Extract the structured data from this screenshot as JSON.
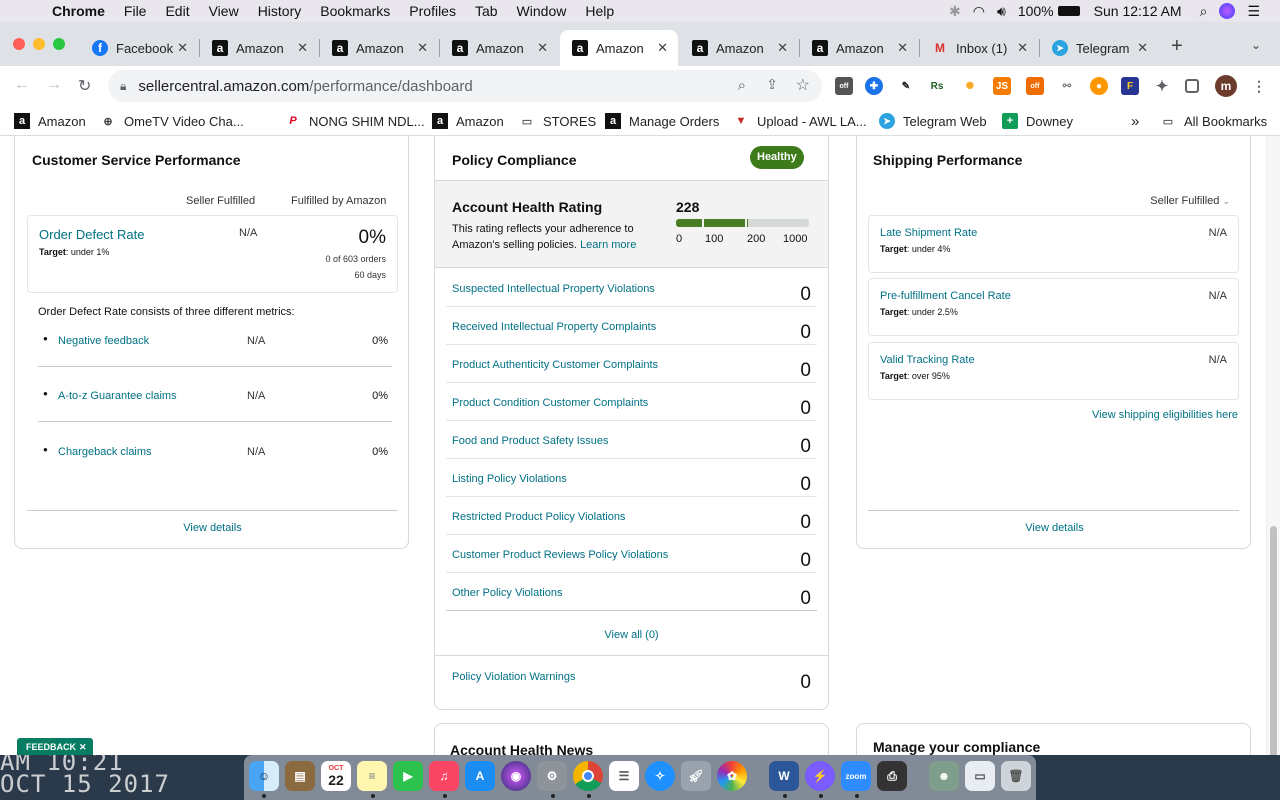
{
  "menubar": {
    "app": "Chrome",
    "items": [
      "File",
      "Edit",
      "View",
      "History",
      "Bookmarks",
      "Profiles",
      "Tab",
      "Window",
      "Help"
    ],
    "battery": "100%",
    "clock": "Sun 12:12 AM"
  },
  "tabs": [
    {
      "title": "Facebook",
      "icon": "facebook-icon"
    },
    {
      "title": "Amazon",
      "icon": "amazon-icon"
    },
    {
      "title": "Amazon",
      "icon": "amazon-icon"
    },
    {
      "title": "Amazon",
      "icon": "amazon-icon"
    },
    {
      "title": "Amazon",
      "icon": "amazon-icon",
      "active": true
    },
    {
      "title": "Amazon",
      "icon": "amazon-icon"
    },
    {
      "title": "Amazon",
      "icon": "amazon-icon"
    },
    {
      "title": "Inbox (1)",
      "icon": "gmail-icon"
    },
    {
      "title": "Telegram",
      "icon": "telegram-icon"
    }
  ],
  "address": {
    "host": "sellercentral.amazon.com",
    "path": "/performance/dashboard"
  },
  "bookmarks": [
    {
      "label": "Amazon"
    },
    {
      "label": "OmeTV Video Cha..."
    },
    {
      "label": "NONG SHIM NDL..."
    },
    {
      "label": "Amazon"
    },
    {
      "label": "STORES"
    },
    {
      "label": "Manage Orders"
    },
    {
      "label": "Upload - AWL LA..."
    },
    {
      "label": "Telegram Web"
    },
    {
      "label": "Downey"
    }
  ],
  "bookmarks_more": "»",
  "all_bookmarks": "All Bookmarks",
  "csp": {
    "title": "Customer Service Performance",
    "col1": "Seller Fulfilled",
    "col2": "Fulfilled by Amazon",
    "odr_label": "Order Defect Rate",
    "odr_target_prefix": "Target",
    "odr_target": ": under 1%",
    "odr_sf": "N/A",
    "odr_fba": "0%",
    "odr_orders": "0 of 603 orders",
    "odr_days": "60 days",
    "consists": "Order Defect Rate consists of three different metrics:",
    "metrics": [
      {
        "label": "Negative feedback",
        "sf": "N/A",
        "fba": "0%"
      },
      {
        "label": "A-to-z Guarantee claims",
        "sf": "N/A",
        "fba": "0%"
      },
      {
        "label": "Chargeback claims",
        "sf": "N/A",
        "fba": "0%"
      }
    ],
    "view_details": "View details"
  },
  "policy": {
    "title": "Policy Compliance",
    "badge": "Healthy",
    "ahr_title": "Account Health Rating",
    "ahr_desc1": "This rating reflects your adherence to",
    "ahr_desc2": "Amazon's selling policies.",
    "learn_more": "Learn more",
    "score": "228",
    "score_fraction": 0.228,
    "scale": [
      "0",
      "100",
      "200",
      "1000"
    ],
    "rows": [
      {
        "label": "Suspected Intellectual Property Violations",
        "value": "0"
      },
      {
        "label": "Received Intellectual Property Complaints",
        "value": "0"
      },
      {
        "label": "Product Authenticity Customer Complaints",
        "value": "0"
      },
      {
        "label": "Product Condition Customer Complaints",
        "value": "0"
      },
      {
        "label": "Food and Product Safety Issues",
        "value": "0"
      },
      {
        "label": "Listing Policy Violations",
        "value": "0"
      },
      {
        "label": "Restricted Product Policy Violations",
        "value": "0"
      },
      {
        "label": "Customer Product Reviews Policy Violations",
        "value": "0"
      },
      {
        "label": "Other Policy Violations",
        "value": "0"
      }
    ],
    "view_all": "View all (0)",
    "warnings_label": "Policy Violation Warnings",
    "warnings_value": "0",
    "news_title": "Account Health News"
  },
  "shipping": {
    "title": "Shipping Performance",
    "filter": "Seller Fulfilled",
    "rows": [
      {
        "label": "Late Shipment Rate",
        "target": ": under 4%",
        "value": "N/A"
      },
      {
        "label": "Pre-fulfillment Cancel Rate",
        "target": ": under 2.5%",
        "value": "N/A"
      },
      {
        "label": "Valid Tracking Rate",
        "target": ": over 95%",
        "value": "N/A"
      }
    ],
    "target_prefix": "Target",
    "eligibilities": "View shipping eligibilities here",
    "view_details": "View details",
    "manage_title": "Manage your compliance"
  },
  "feedback": "FEEDBACK",
  "wallpaper_text": {
    "line1": "AM 10:21",
    "line2": "OCT 15 2017"
  },
  "dock_calendar": {
    "month": "OCT",
    "day": "22"
  },
  "dock_zoom": "zoom",
  "colors": {
    "link": "#007185",
    "healthy": "#3c7a1a",
    "bar_green": "#4a7c23"
  }
}
